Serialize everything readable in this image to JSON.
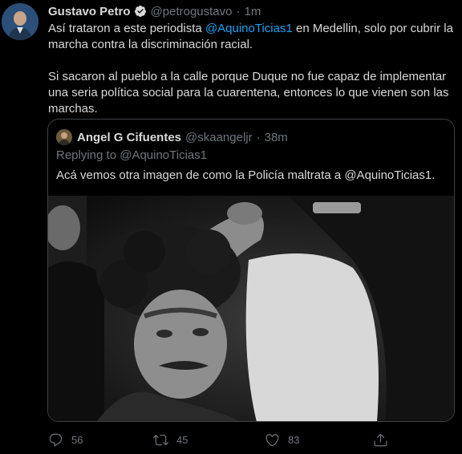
{
  "tweet": {
    "display_name": "Gustavo Petro",
    "handle": "@petrogustavo",
    "separator": "·",
    "time": "1m",
    "text_part1": "Así trataron a este periodista ",
    "mention": "@AquinoTicias1",
    "text_part2": " en Medellin, solo por cubrir la marcha contra la discriminación racial.",
    "paragraph2": "Si sacaron al pueblo a la calle porque Duque no fue capaz de implementar una seria política social para la cuarentena, entonces lo que vienen son las marchas.",
    "verified_icon": "verified-badge-icon"
  },
  "quoted_tweet": {
    "display_name": "Angel G Cifuentes",
    "handle": "@skaangeljr",
    "separator": "·",
    "time": "38m",
    "replying_to": "Replying to @AquinoTicias1",
    "text": "Acá vemos otra imagen de como la Policía maltrata a @AquinoTicias1."
  },
  "actions": {
    "reply_count": "56",
    "retweet_count": "45",
    "like_count": "83",
    "icons": [
      "reply-icon",
      "retweet-icon",
      "like-icon",
      "share-icon"
    ]
  },
  "colors": {
    "background": "#000000",
    "text": "#d9d9d9",
    "muted": "#6e767d",
    "link": "#1da1f2",
    "border": "#3d4143"
  }
}
